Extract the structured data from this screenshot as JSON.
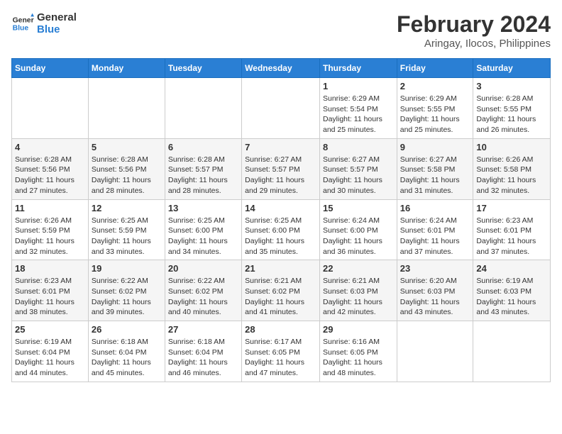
{
  "logo": {
    "line1": "General",
    "line2": "Blue"
  },
  "title": "February 2024",
  "subtitle": "Aringay, Ilocos, Philippines",
  "days_of_week": [
    "Sunday",
    "Monday",
    "Tuesday",
    "Wednesday",
    "Thursday",
    "Friday",
    "Saturday"
  ],
  "weeks": [
    [
      {
        "num": "",
        "detail": ""
      },
      {
        "num": "",
        "detail": ""
      },
      {
        "num": "",
        "detail": ""
      },
      {
        "num": "",
        "detail": ""
      },
      {
        "num": "1",
        "detail": "Sunrise: 6:29 AM\nSunset: 5:54 PM\nDaylight: 11 hours\nand 25 minutes."
      },
      {
        "num": "2",
        "detail": "Sunrise: 6:29 AM\nSunset: 5:55 PM\nDaylight: 11 hours\nand 25 minutes."
      },
      {
        "num": "3",
        "detail": "Sunrise: 6:28 AM\nSunset: 5:55 PM\nDaylight: 11 hours\nand 26 minutes."
      }
    ],
    [
      {
        "num": "4",
        "detail": "Sunrise: 6:28 AM\nSunset: 5:56 PM\nDaylight: 11 hours\nand 27 minutes."
      },
      {
        "num": "5",
        "detail": "Sunrise: 6:28 AM\nSunset: 5:56 PM\nDaylight: 11 hours\nand 28 minutes."
      },
      {
        "num": "6",
        "detail": "Sunrise: 6:28 AM\nSunset: 5:57 PM\nDaylight: 11 hours\nand 28 minutes."
      },
      {
        "num": "7",
        "detail": "Sunrise: 6:27 AM\nSunset: 5:57 PM\nDaylight: 11 hours\nand 29 minutes."
      },
      {
        "num": "8",
        "detail": "Sunrise: 6:27 AM\nSunset: 5:57 PM\nDaylight: 11 hours\nand 30 minutes."
      },
      {
        "num": "9",
        "detail": "Sunrise: 6:27 AM\nSunset: 5:58 PM\nDaylight: 11 hours\nand 31 minutes."
      },
      {
        "num": "10",
        "detail": "Sunrise: 6:26 AM\nSunset: 5:58 PM\nDaylight: 11 hours\nand 32 minutes."
      }
    ],
    [
      {
        "num": "11",
        "detail": "Sunrise: 6:26 AM\nSunset: 5:59 PM\nDaylight: 11 hours\nand 32 minutes."
      },
      {
        "num": "12",
        "detail": "Sunrise: 6:25 AM\nSunset: 5:59 PM\nDaylight: 11 hours\nand 33 minutes."
      },
      {
        "num": "13",
        "detail": "Sunrise: 6:25 AM\nSunset: 6:00 PM\nDaylight: 11 hours\nand 34 minutes."
      },
      {
        "num": "14",
        "detail": "Sunrise: 6:25 AM\nSunset: 6:00 PM\nDaylight: 11 hours\nand 35 minutes."
      },
      {
        "num": "15",
        "detail": "Sunrise: 6:24 AM\nSunset: 6:00 PM\nDaylight: 11 hours\nand 36 minutes."
      },
      {
        "num": "16",
        "detail": "Sunrise: 6:24 AM\nSunset: 6:01 PM\nDaylight: 11 hours\nand 37 minutes."
      },
      {
        "num": "17",
        "detail": "Sunrise: 6:23 AM\nSunset: 6:01 PM\nDaylight: 11 hours\nand 37 minutes."
      }
    ],
    [
      {
        "num": "18",
        "detail": "Sunrise: 6:23 AM\nSunset: 6:01 PM\nDaylight: 11 hours\nand 38 minutes."
      },
      {
        "num": "19",
        "detail": "Sunrise: 6:22 AM\nSunset: 6:02 PM\nDaylight: 11 hours\nand 39 minutes."
      },
      {
        "num": "20",
        "detail": "Sunrise: 6:22 AM\nSunset: 6:02 PM\nDaylight: 11 hours\nand 40 minutes."
      },
      {
        "num": "21",
        "detail": "Sunrise: 6:21 AM\nSunset: 6:02 PM\nDaylight: 11 hours\nand 41 minutes."
      },
      {
        "num": "22",
        "detail": "Sunrise: 6:21 AM\nSunset: 6:03 PM\nDaylight: 11 hours\nand 42 minutes."
      },
      {
        "num": "23",
        "detail": "Sunrise: 6:20 AM\nSunset: 6:03 PM\nDaylight: 11 hours\nand 43 minutes."
      },
      {
        "num": "24",
        "detail": "Sunrise: 6:19 AM\nSunset: 6:03 PM\nDaylight: 11 hours\nand 43 minutes."
      }
    ],
    [
      {
        "num": "25",
        "detail": "Sunrise: 6:19 AM\nSunset: 6:04 PM\nDaylight: 11 hours\nand 44 minutes."
      },
      {
        "num": "26",
        "detail": "Sunrise: 6:18 AM\nSunset: 6:04 PM\nDaylight: 11 hours\nand 45 minutes."
      },
      {
        "num": "27",
        "detail": "Sunrise: 6:18 AM\nSunset: 6:04 PM\nDaylight: 11 hours\nand 46 minutes."
      },
      {
        "num": "28",
        "detail": "Sunrise: 6:17 AM\nSunset: 6:05 PM\nDaylight: 11 hours\nand 47 minutes."
      },
      {
        "num": "29",
        "detail": "Sunrise: 6:16 AM\nSunset: 6:05 PM\nDaylight: 11 hours\nand 48 minutes."
      },
      {
        "num": "",
        "detail": ""
      },
      {
        "num": "",
        "detail": ""
      }
    ]
  ]
}
